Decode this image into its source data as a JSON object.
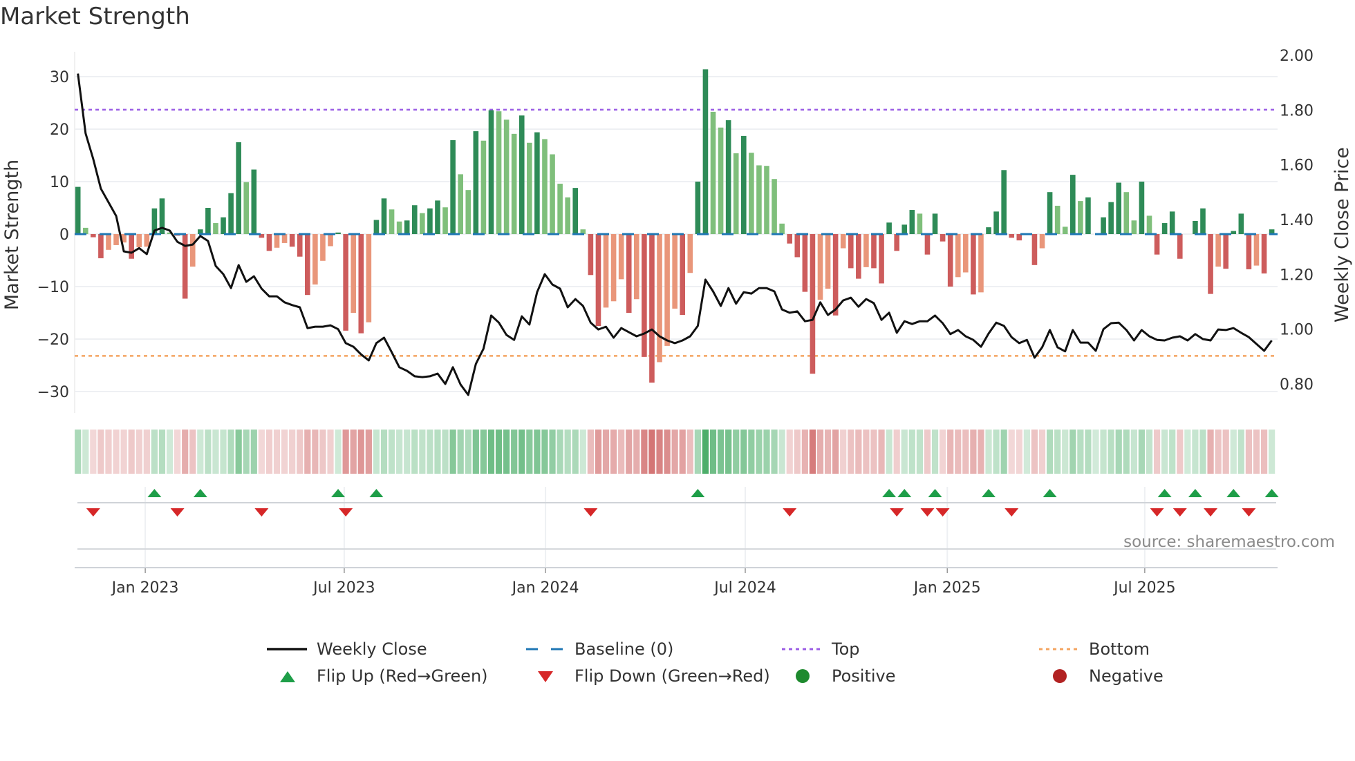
{
  "title": "Market Strength",
  "source": "source: sharemaestro.com",
  "colors": {
    "pos_strong": "#2e8b57",
    "pos_weak": "#7fbf7b",
    "neg_strong": "#cd5c5c",
    "neg_weak": "#e9967a",
    "baseline": "#1f77b4",
    "top": "#9b5de5",
    "bottom": "#f4a460",
    "flip_up": "#1e9e48",
    "flip_down": "#d62728",
    "positive": "#1e8a2e",
    "negative": "#b22222",
    "price": "#111111"
  },
  "legend": [
    {
      "label": "Weekly Close",
      "icon": "solid-line"
    },
    {
      "label": "Baseline (0)",
      "icon": "dashed-line"
    },
    {
      "label": "Top",
      "icon": "dotted-line"
    },
    {
      "label": "Bottom",
      "icon": "dotted-line"
    },
    {
      "label": "Flip Up (Red→Green)",
      "icon": "triangle-up"
    },
    {
      "label": "Flip Down (Green→Red)",
      "icon": "triangle-down"
    },
    {
      "label": "Positive",
      "icon": "circle"
    },
    {
      "label": "Negative",
      "icon": "circle"
    }
  ],
  "chart_data": {
    "type": "bar",
    "title": "Market Strength",
    "ylabel": "Market Strength",
    "y2label": "Weekly Close Price",
    "ylim": [
      -33,
      33.5
    ],
    "y2lim": [
      0.735,
      2.0
    ],
    "yticks": [
      "−30",
      "−20",
      "−10",
      "0",
      "10",
      "20",
      "30"
    ],
    "ytick_values": [
      -30,
      -20,
      -10,
      0,
      10,
      20,
      30
    ],
    "y2ticks": [
      "0.80",
      "1.00",
      "1.20",
      "1.40",
      "1.60",
      "1.80",
      "2.00"
    ],
    "y2tick_values": [
      0.8,
      1.0,
      1.2,
      1.4,
      1.6,
      1.8,
      2.0
    ],
    "x_ticks": [
      {
        "label": "Jan 2023",
        "week": 8.8
      },
      {
        "label": "Jul 2023",
        "week": 34.8
      },
      {
        "label": "Jan 2024",
        "week": 61.1
      },
      {
        "label": "Jul 2024",
        "week": 87.2
      },
      {
        "label": "Jan 2025",
        "week": 113.6
      },
      {
        "label": "Jul 2025",
        "week": 139.4
      }
    ],
    "top_level": 23.7,
    "bottom_level": -23.2,
    "baseline": 0,
    "grid": true,
    "legend_placement": "bottom",
    "strength": [
      9.0,
      1.2,
      -0.6,
      -4.6,
      -3.0,
      -2.1,
      -1.6,
      -4.7,
      -2.5,
      -2.4,
      4.9,
      6.8,
      0.3,
      -0.3,
      -12.3,
      -6.2,
      0.9,
      5.0,
      2.1,
      3.2,
      7.8,
      17.5,
      9.9,
      12.3,
      -0.7,
      -3.2,
      -2.6,
      -1.7,
      -2.4,
      -4.3,
      -11.6,
      -9.6,
      -5.1,
      -2.3,
      0.3,
      -18.4,
      -15.0,
      -18.9,
      -16.8,
      2.7,
      6.8,
      4.7,
      2.4,
      2.6,
      5.5,
      4.0,
      4.9,
      6.4,
      5.1,
      17.9,
      11.4,
      8.4,
      19.6,
      17.8,
      23.6,
      23.4,
      21.8,
      19.1,
      22.6,
      17.4,
      19.4,
      18.1,
      15.2,
      9.6,
      7.0,
      8.8,
      0.9,
      -7.8,
      -17.5,
      -14.0,
      -12.8,
      -8.6,
      -15.0,
      -12.4,
      -23.4,
      -28.3,
      -24.4,
      -21.3,
      -14.2,
      -15.4,
      -7.4,
      10.0,
      31.4,
      23.3,
      20.3,
      21.7,
      15.4,
      18.7,
      15.5,
      13.1,
      13.0,
      10.5,
      2.0,
      -1.8,
      -4.4,
      -11.0,
      -26.6,
      -12.5,
      -10.4,
      -15.5,
      -2.7,
      -6.5,
      -8.5,
      -6.3,
      -6.5,
      -9.4,
      2.2,
      -3.2,
      1.8,
      4.6,
      3.9,
      -3.9,
      3.9,
      -1.4,
      -10.0,
      -8.2,
      -7.3,
      -11.5,
      -11.1,
      1.3,
      4.3,
      12.2,
      -0.7,
      -1.2,
      0,
      -5.9,
      -2.7,
      8.0,
      5.4,
      1.4,
      11.3,
      6.3,
      7.0,
      0,
      3.2,
      6.1,
      9.8,
      8.0,
      2.6,
      10.0,
      3.5,
      -3.9,
      2.1,
      4.3,
      -4.7,
      0,
      2.5,
      4.9,
      -11.4,
      -6.2,
      -6.6,
      0.6,
      3.9,
      -6.7,
      -6.0,
      -7.5,
      0.9
    ],
    "weekly_close": [
      1.933,
      1.715,
      1.622,
      1.513,
      1.463,
      1.413,
      1.284,
      1.279,
      1.296,
      1.274,
      1.36,
      1.37,
      1.36,
      1.319,
      1.304,
      1.309,
      1.34,
      1.322,
      1.231,
      1.201,
      1.15,
      1.234,
      1.173,
      1.193,
      1.148,
      1.12,
      1.12,
      1.098,
      1.088,
      1.08,
      1.004,
      1.009,
      1.009,
      1.014,
      1.0,
      0.949,
      0.936,
      0.908,
      0.886,
      0.949,
      0.969,
      0.916,
      0.861,
      0.848,
      0.828,
      0.825,
      0.828,
      0.838,
      0.8,
      0.861,
      0.798,
      0.76,
      0.873,
      0.929,
      1.05,
      1.024,
      0.979,
      0.961,
      1.047,
      1.017,
      1.135,
      1.201,
      1.163,
      1.148,
      1.08,
      1.11,
      1.085,
      1.024,
      0.999,
      1.009,
      0.969,
      1.004,
      0.989,
      0.974,
      0.984,
      0.999,
      0.974,
      0.959,
      0.949,
      0.959,
      0.974,
      1.012,
      1.181,
      1.138,
      1.085,
      1.15,
      1.093,
      1.135,
      1.13,
      1.15,
      1.15,
      1.138,
      1.072,
      1.06,
      1.065,
      1.029,
      1.034,
      1.098,
      1.052,
      1.072,
      1.105,
      1.115,
      1.082,
      1.11,
      1.095,
      1.034,
      1.06,
      0.987,
      1.029,
      1.019,
      1.029,
      1.029,
      1.05,
      1.022,
      0.982,
      0.997,
      0.974,
      0.961,
      0.936,
      0.984,
      1.024,
      1.012,
      0.971,
      0.949,
      0.961,
      0.896,
      0.934,
      0.997,
      0.934,
      0.919,
      0.997,
      0.951,
      0.951,
      0.921,
      1.0,
      1.022,
      1.024,
      0.997,
      0.959,
      0.997,
      0.974,
      0.961,
      0.959,
      0.969,
      0.974,
      0.959,
      0.982,
      0.964,
      0.959,
      0.999,
      0.997,
      1.004,
      0.987,
      0.971,
      0.946,
      0.921,
      0.959
    ]
  }
}
